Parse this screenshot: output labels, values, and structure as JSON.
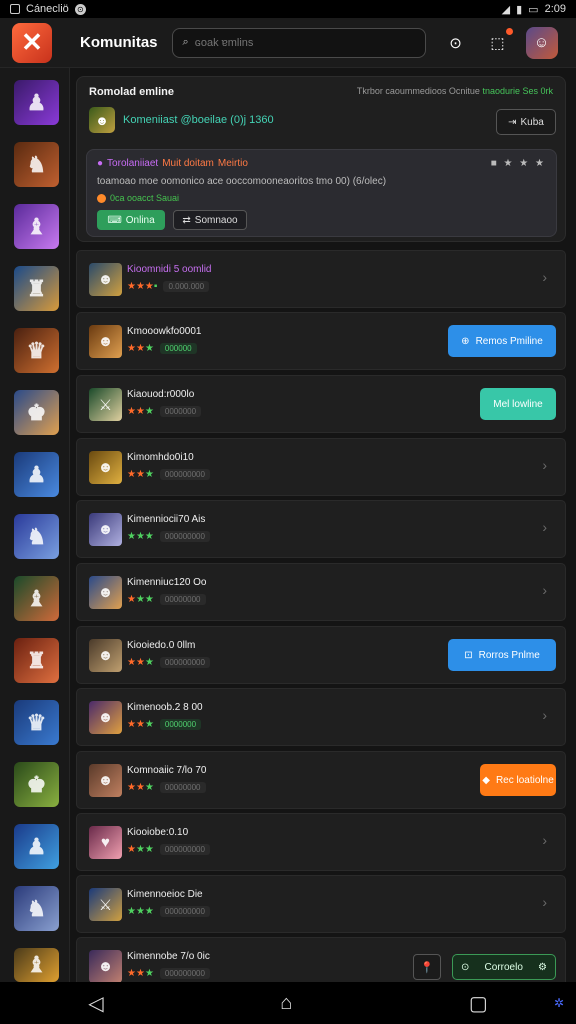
{
  "status_bar": {
    "left_text": "Cánecliö",
    "time": "2:09"
  },
  "header": {
    "logo_glyph": "✕",
    "title": "Komunitas",
    "search_placeholder": "ɢoak ɐmlins",
    "search_icon": "search-icon",
    "settings_icon": "settings-icon",
    "notify_icon": "notification-icon"
  },
  "colors": {
    "accent_green": "#2e9e5b",
    "accent_blue": "#2d8fe8",
    "accent_teal": "#38c7a8",
    "accent_orange": "#ff7a15",
    "accent_purple": "#c66ff0"
  },
  "panel": {
    "title": "Romolad emline",
    "meta": "Tkrbor caoummedioos  Ocnitue",
    "meta_green": "tnaodurie Ses 0rk",
    "subtitle": "Komeniiast @boeilae (0)j 1360",
    "button": "Kuba",
    "inner": {
      "line1": "Torolaniiaet ",
      "line1_orange": "Muit doitam ",
      "line1_end": "Meirtio",
      "line2": "toamoao moe oomonico ace ooccomooneaoritos tmo 00) (6/olec)",
      "line3": "0ca ooacct Sauai",
      "btn_primary": "Onlina",
      "btn_secondary": "Somnaoo",
      "stars": "■ ★ ★ ★"
    }
  },
  "rows": [
    {
      "name": "Kioomnidi 5 oomlid",
      "stars": "★★★",
      "tag": "0.000.000",
      "action": "chevron"
    },
    {
      "name": "Kmooowkfo0001",
      "stars": "★★★",
      "tag": "000000",
      "action": "Remos Pmiline"
    },
    {
      "name": "Kiaouod:r000lo",
      "stars": "★★★",
      "tag": "0000000",
      "action": "Mel lowline"
    },
    {
      "name": "Kimomhdo0i10",
      "stars": "★★★",
      "tag": "000000000",
      "action": "chevron"
    },
    {
      "name": "Kimenniocii70 Ais",
      "stars": "★★★",
      "tag": "000000000",
      "action": "chevron"
    },
    {
      "name": "Kimenniuc120 Oo",
      "stars": "★★★",
      "tag": "00000000",
      "action": "chevron"
    },
    {
      "name": "Kiooiedo.0 0llm",
      "stars": "★★★",
      "tag": "000000000",
      "action": "Rorros Pnlme"
    },
    {
      "name": "Kimenoob.2 8 00",
      "stars": "★★★",
      "tag": "0000000",
      "action": "chevron"
    },
    {
      "name": "Komnoaiic 7/lo 70",
      "stars": "★★★",
      "tag": "00000000",
      "action": "Rec loatiolne"
    },
    {
      "name": "Kiooiobe:0.10",
      "stars": "★★★",
      "tag": "000000000",
      "action": "chevron"
    },
    {
      "name": "Kimennoeioc Die",
      "stars": "★★★",
      "tag": "000000000",
      "action": "chevron"
    },
    {
      "name": "Kimennobe 7/o 0ic",
      "stars": "★★★",
      "tag": "000000000",
      "action": "Corroelo"
    }
  ],
  "navbar": {
    "back_icon": "back-icon",
    "home_icon": "home-icon",
    "recent_icon": "recents-icon"
  }
}
